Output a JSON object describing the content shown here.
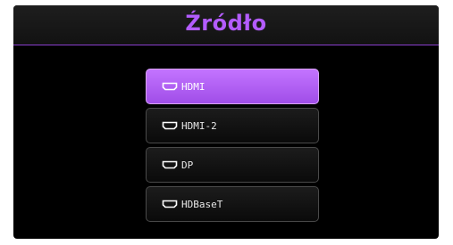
{
  "window": {
    "title": "Źródło"
  },
  "source_menu": {
    "items": [
      {
        "label": "HDMI",
        "icon": "hdmi-port-icon",
        "selected": true
      },
      {
        "label": "HDMI-2",
        "icon": "hdmi-port-icon",
        "selected": false
      },
      {
        "label": "DP",
        "icon": "hdmi-port-icon",
        "selected": false
      },
      {
        "label": "HDBaseT",
        "icon": "hdmi-port-icon",
        "selected": false
      }
    ]
  },
  "colors": {
    "accent": "#b35cff",
    "selected_bg": "#b066f5",
    "background": "#000000"
  }
}
